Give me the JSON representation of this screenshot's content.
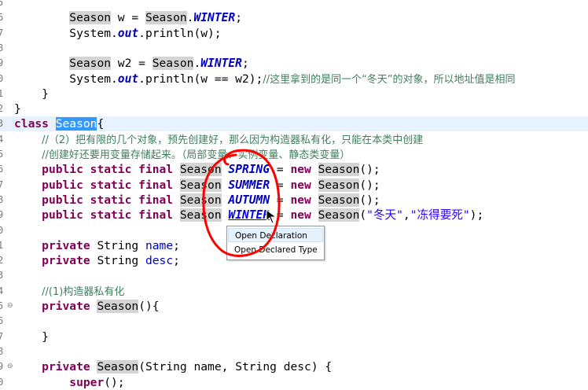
{
  "editor": {
    "lines": [
      {
        "num": "5",
        "segments": [
          {
            "t": ""
          }
        ]
      },
      {
        "num": "6",
        "segments": [
          {
            "t": "        "
          },
          {
            "t": "Season",
            "c": "occ"
          },
          {
            "t": " w = "
          },
          {
            "t": "Season",
            "c": "occ"
          },
          {
            "t": "."
          },
          {
            "t": "WINTER",
            "c": "sfld"
          },
          {
            "t": ";"
          }
        ]
      },
      {
        "num": "7",
        "segments": [
          {
            "t": "        System."
          },
          {
            "t": "out",
            "c": "sfld"
          },
          {
            "t": ".println(w);"
          }
        ]
      },
      {
        "num": "8",
        "segments": [
          {
            "t": ""
          }
        ]
      },
      {
        "num": "9",
        "segments": [
          {
            "t": "        "
          },
          {
            "t": "Season",
            "c": "occ"
          },
          {
            "t": " w2 = "
          },
          {
            "t": "Season",
            "c": "occ"
          },
          {
            "t": "."
          },
          {
            "t": "WINTER",
            "c": "sfld"
          },
          {
            "t": ";"
          }
        ]
      },
      {
        "num": "0",
        "segments": [
          {
            "t": "        System."
          },
          {
            "t": "out",
            "c": "sfld"
          },
          {
            "t": ".println(w == w2);"
          },
          {
            "t": "//这里拿到的是同一个“冬天”的对象，所以地址值是相同",
            "c": "cmt"
          }
        ]
      },
      {
        "num": "1",
        "segments": [
          {
            "t": "    }"
          }
        ]
      },
      {
        "num": "2",
        "segments": [
          {
            "t": "}"
          }
        ]
      },
      {
        "num": "3",
        "current": true,
        "segments": [
          {
            "t": "class",
            "c": "kw"
          },
          {
            "t": " "
          },
          {
            "t": "Season",
            "c": "sel"
          },
          {
            "t": "{"
          }
        ]
      },
      {
        "num": "4",
        "segments": [
          {
            "t": "    "
          },
          {
            "t": "//（2）把有限的几个对象，预先创建好，那么因为构造器私有化，只能在本类中创建",
            "c": "cmt"
          }
        ]
      },
      {
        "num": "5",
        "segments": [
          {
            "t": "    "
          },
          {
            "t": "//创建好还要用变量存储起来。（局部变量、实例变量、静态类变量）",
            "c": "cmt"
          }
        ]
      },
      {
        "num": "6",
        "segments": [
          {
            "t": "    "
          },
          {
            "t": "public static final",
            "c": "kw"
          },
          {
            "t": " "
          },
          {
            "t": "Season",
            "c": "occ"
          },
          {
            "t": " "
          },
          {
            "t": "SPRING",
            "c": "sfld"
          },
          {
            "t": " = "
          },
          {
            "t": "new",
            "c": "kw"
          },
          {
            "t": " "
          },
          {
            "t": "Season",
            "c": "occ"
          },
          {
            "t": "();"
          }
        ]
      },
      {
        "num": "7",
        "segments": [
          {
            "t": "    "
          },
          {
            "t": "public static final",
            "c": "kw"
          },
          {
            "t": " "
          },
          {
            "t": "Season",
            "c": "occ"
          },
          {
            "t": " "
          },
          {
            "t": "SUMMER",
            "c": "sfld"
          },
          {
            "t": " = "
          },
          {
            "t": "new",
            "c": "kw"
          },
          {
            "t": " "
          },
          {
            "t": "Season",
            "c": "occ"
          },
          {
            "t": "();"
          }
        ]
      },
      {
        "num": "8",
        "segments": [
          {
            "t": "    "
          },
          {
            "t": "public static final",
            "c": "kw"
          },
          {
            "t": " "
          },
          {
            "t": "Season",
            "c": "occ"
          },
          {
            "t": " "
          },
          {
            "t": "AUTUMN",
            "c": "sfld"
          },
          {
            "t": " = "
          },
          {
            "t": "new",
            "c": "kw"
          },
          {
            "t": " "
          },
          {
            "t": "Season",
            "c": "occ"
          },
          {
            "t": "();"
          }
        ]
      },
      {
        "num": "9",
        "segments": [
          {
            "t": "    "
          },
          {
            "t": "public static final",
            "c": "kw"
          },
          {
            "t": " "
          },
          {
            "t": "Season",
            "c": "occ"
          },
          {
            "t": " "
          },
          {
            "t": "WINTER",
            "c": "sfld link"
          },
          {
            "t": " = "
          },
          {
            "t": "new",
            "c": "kw"
          },
          {
            "t": " "
          },
          {
            "t": "Season",
            "c": "occ"
          },
          {
            "t": "("
          },
          {
            "t": "\"冬天\"",
            "c": "str"
          },
          {
            "t": ","
          },
          {
            "t": "\"冻得要死\"",
            "c": "str"
          },
          {
            "t": ");"
          }
        ]
      },
      {
        "num": "0",
        "segments": [
          {
            "t": ""
          }
        ]
      },
      {
        "num": "1",
        "segments": [
          {
            "t": "    "
          },
          {
            "t": "private",
            "c": "kw"
          },
          {
            "t": " String "
          },
          {
            "t": "name",
            "c": "fld"
          },
          {
            "t": ";"
          }
        ]
      },
      {
        "num": "2",
        "segments": [
          {
            "t": "    "
          },
          {
            "t": "private",
            "c": "kw"
          },
          {
            "t": " String "
          },
          {
            "t": "desc",
            "c": "fld"
          },
          {
            "t": ";"
          }
        ]
      },
      {
        "num": "3",
        "segments": [
          {
            "t": ""
          }
        ]
      },
      {
        "num": "4",
        "segments": [
          {
            "t": "    "
          },
          {
            "t": "//(1)构造器私有化",
            "c": "cmt"
          }
        ]
      },
      {
        "num": "5",
        "fold": "⊖",
        "segments": [
          {
            "t": "    "
          },
          {
            "t": "private",
            "c": "kw"
          },
          {
            "t": " "
          },
          {
            "t": "Season",
            "c": "occ"
          },
          {
            "t": "(){"
          }
        ]
      },
      {
        "num": "6",
        "segments": [
          {
            "t": ""
          }
        ]
      },
      {
        "num": "7",
        "segments": [
          {
            "t": "    }"
          }
        ]
      },
      {
        "num": "8",
        "segments": [
          {
            "t": ""
          }
        ]
      },
      {
        "num": "9",
        "fold": "⊖",
        "segments": [
          {
            "t": "    "
          },
          {
            "t": "private",
            "c": "kw"
          },
          {
            "t": " "
          },
          {
            "t": "Season",
            "c": "occ"
          },
          {
            "t": "(String name, String desc) {"
          }
        ]
      },
      {
        "num": "0",
        "segments": [
          {
            "t": "        "
          },
          {
            "t": "super",
            "c": "kw"
          },
          {
            "t": "();"
          }
        ]
      }
    ]
  },
  "context_menu": {
    "items": [
      {
        "label": "Open Declaration",
        "highlighted": true
      },
      {
        "label": "Open Declared Type",
        "highlighted": false
      }
    ]
  },
  "colors": {
    "keyword": "#7f0055",
    "field": "#0000c0",
    "comment": "#3f7f5f",
    "string": "#2a00ff",
    "annotation_circle": "#ff0000"
  }
}
